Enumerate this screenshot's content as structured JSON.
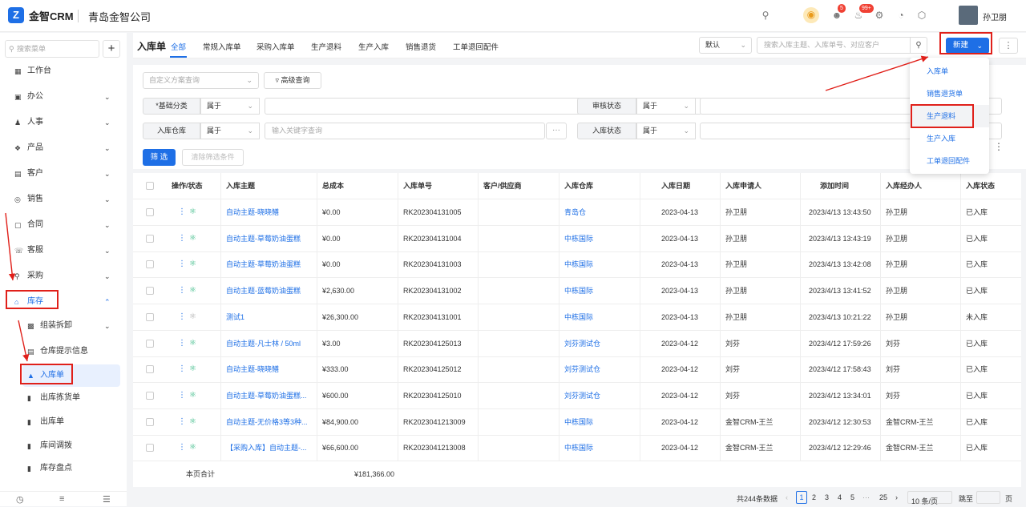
{
  "header": {
    "brand": "金智CRM",
    "company": "青岛金智公司",
    "user_name": "孙卫朋",
    "badges": {
      "contacts": "5",
      "notifications": "99+"
    }
  },
  "sidebar": {
    "search_placeholder": "搜索菜单",
    "add_label": "+",
    "items": [
      {
        "label": "工作台",
        "icon": "dashboard-icon"
      },
      {
        "label": "办公",
        "icon": "office-icon"
      },
      {
        "label": "人事",
        "icon": "people-icon"
      },
      {
        "label": "产品",
        "icon": "product-icon"
      },
      {
        "label": "客户",
        "icon": "customer-icon"
      },
      {
        "label": "销售",
        "icon": "sales-icon"
      },
      {
        "label": "合同",
        "icon": "contract-icon"
      },
      {
        "label": "客服",
        "icon": "service-icon"
      },
      {
        "label": "采购",
        "icon": "purchase-icon"
      },
      {
        "label": "库存",
        "icon": "warehouse-icon"
      },
      {
        "label": "组装拆卸",
        "icon": "assembly-icon"
      },
      {
        "label": "仓库提示信息",
        "icon": "info-icon"
      },
      {
        "label": "入库单",
        "icon": "stock-in-icon"
      },
      {
        "label": "出库拣货单",
        "icon": "picking-icon"
      },
      {
        "label": "出库单",
        "icon": "stock-out-icon"
      },
      {
        "label": "库间调拨",
        "icon": "transfer-icon"
      },
      {
        "label": "库存盘点",
        "icon": "inventory-check-icon"
      }
    ]
  },
  "page": {
    "title": "入库单",
    "tabs": [
      "全部",
      "常规入库单",
      "采购入库单",
      "生产退料",
      "生产入库",
      "销售退货",
      "工单退回配件"
    ],
    "view_select": "默认",
    "search_placeholder": "搜索入库主题、入库单号、对应客户",
    "new_button": "新建"
  },
  "new_menu": {
    "items": [
      "入库单",
      "销售退货单",
      "生产退料",
      "生产入库",
      "工单退回配件"
    ]
  },
  "filters": {
    "custom_scheme_placeholder": "自定义方案查询",
    "advanced_query": "高级查询",
    "rows": [
      {
        "label": "*基础分类",
        "op": "属于",
        "value": ""
      },
      {
        "label": "审核状态",
        "op": "属于",
        "value": ""
      },
      {
        "label": "入库仓库",
        "op": "属于",
        "value": "输入关键字查询"
      },
      {
        "label": "入库状态",
        "op": "属于",
        "value": ""
      }
    ],
    "filter_button": "筛 选",
    "clear_button": "清除筛选条件"
  },
  "table": {
    "columns": [
      "操作/状态",
      "入库主题",
      "总成本",
      "入库单号",
      "客户/供应商",
      "入库仓库",
      "入库日期",
      "入库申请人",
      "添加时间",
      "入库经办人",
      "入库状态"
    ],
    "rows": [
      {
        "subject": "自动主题-晓晓鳝",
        "cost": "¥0.00",
        "no": "RK202304131005",
        "client": "",
        "warehouse": "青岛仓",
        "date": "2023-04-13",
        "applicant": "孙卫朋",
        "added": "2023/4/13 13:43:50",
        "handler": "孙卫朋",
        "status": "已入库"
      },
      {
        "subject": "自动主题-草莓奶油蛋糕",
        "cost": "¥0.00",
        "no": "RK202304131004",
        "client": "",
        "warehouse": "中栋国际",
        "date": "2023-04-13",
        "applicant": "孙卫朋",
        "added": "2023/4/13 13:43:19",
        "handler": "孙卫朋",
        "status": "已入库"
      },
      {
        "subject": "自动主题-草莓奶油蛋糕",
        "cost": "¥0.00",
        "no": "RK202304131003",
        "client": "",
        "warehouse": "中栋国际",
        "date": "2023-04-13",
        "applicant": "孙卫朋",
        "added": "2023/4/13 13:42:08",
        "handler": "孙卫朋",
        "status": "已入库"
      },
      {
        "subject": "自动主题-蓝莓奶油蛋糕",
        "cost": "¥2,630.00",
        "no": "RK202304131002",
        "client": "",
        "warehouse": "中栋国际",
        "date": "2023-04-13",
        "applicant": "孙卫朋",
        "added": "2023/4/13 13:41:52",
        "handler": "孙卫朋",
        "status": "已入库"
      },
      {
        "subject": "测试1",
        "cost": "¥26,300.00",
        "no": "RK202304131001",
        "client": "",
        "warehouse": "中栋国际",
        "date": "2023-04-13",
        "applicant": "孙卫朋",
        "added": "2023/4/13 10:21:22",
        "handler": "孙卫朋",
        "status": "未入库"
      },
      {
        "subject": "自动主题-凡士林 / 50ml",
        "cost": "¥3.00",
        "no": "RK202304125013",
        "client": "",
        "warehouse": "刘芬测试仓",
        "date": "2023-04-12",
        "applicant": "刘芬",
        "added": "2023/4/12 17:59:26",
        "handler": "刘芬",
        "status": "已入库"
      },
      {
        "subject": "自动主题-晓晓鳝",
        "cost": "¥333.00",
        "no": "RK202304125012",
        "client": "",
        "warehouse": "刘芬测试仓",
        "date": "2023-04-12",
        "applicant": "刘芬",
        "added": "2023/4/12 17:58:43",
        "handler": "刘芬",
        "status": "已入库"
      },
      {
        "subject": "自动主题-草莓奶油蛋糕...",
        "cost": "¥600.00",
        "no": "RK202304125010",
        "client": "",
        "warehouse": "刘芬测试仓",
        "date": "2023-04-12",
        "applicant": "刘芬",
        "added": "2023/4/12 13:34:01",
        "handler": "刘芬",
        "status": "已入库"
      },
      {
        "subject": "自动主题-无价格3等3种...",
        "cost": "¥84,900.00",
        "no": "RK2023041213009",
        "client": "",
        "warehouse": "中栋国际",
        "date": "2023-04-12",
        "applicant": "金智CRM-王兰",
        "added": "2023/4/12 12:30:53",
        "handler": "金智CRM-王兰",
        "status": "已入库"
      },
      {
        "subject": "【采购入库】自动主题-...",
        "cost": "¥66,600.00",
        "no": "RK2023041213008",
        "client": "",
        "warehouse": "中栋国际",
        "date": "2023-04-12",
        "applicant": "金智CRM-王兰",
        "added": "2023/4/12 12:29:46",
        "handler": "金智CRM-王兰",
        "status": "已入库"
      }
    ],
    "total_label": "本页合计",
    "total_value": "¥181,366.00"
  },
  "pagination": {
    "total": "共244条数据",
    "pages": [
      "1",
      "2",
      "3",
      "4",
      "5",
      "···",
      "25"
    ],
    "per_page": "10 条/页",
    "jump_label": "跳至",
    "page_suffix": "页"
  },
  "colors": {
    "accent": "#1e6fe6",
    "annotation": "#e0201a",
    "status_green": "#2ab57d"
  }
}
